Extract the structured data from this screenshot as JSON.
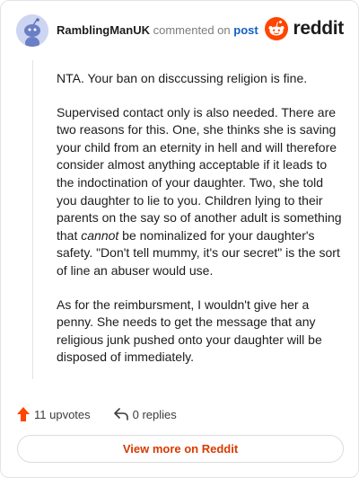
{
  "header": {
    "username": "RamblingManUK",
    "action": "commented on",
    "target": "post",
    "logo_text": "reddit"
  },
  "comment": {
    "paragraphs": [
      {
        "text": "NTA. Your ban on disccussing religion is fine."
      },
      {
        "before": "Supervised contact only is also needed. There are two reasons for this. One, she thinks she is saving your child from an eternity in hell and will therefore consider almost anything acceptable if it leads to the indoctination of your daughter. Two, she told you daughter to lie to you. Children lying to their parents on the say so of another adult is something that ",
        "emphasis": "cannot",
        "after": " be nominalized for your daughter's safety. \"Don't tell mummy, it's our secret\" is the sort of line an abuser would use."
      },
      {
        "text": "As for the reimbursment, I wouldn't give her a penny. She needs to get the message that any religious junk pushed onto your daughter will be disposed of immediately."
      }
    ]
  },
  "footer": {
    "upvotes": "11 upvotes",
    "replies": "0 replies",
    "view_more": "View more on Reddit"
  },
  "colors": {
    "brand": "#ff4500",
    "link": "#1260c6",
    "view_more": "#d93a00"
  },
  "icons": {
    "avatar": "snoo-avatar-icon",
    "logo": "reddit-logo-icon",
    "upvote": "upvote-arrow-icon",
    "reply": "reply-arrow-icon"
  }
}
